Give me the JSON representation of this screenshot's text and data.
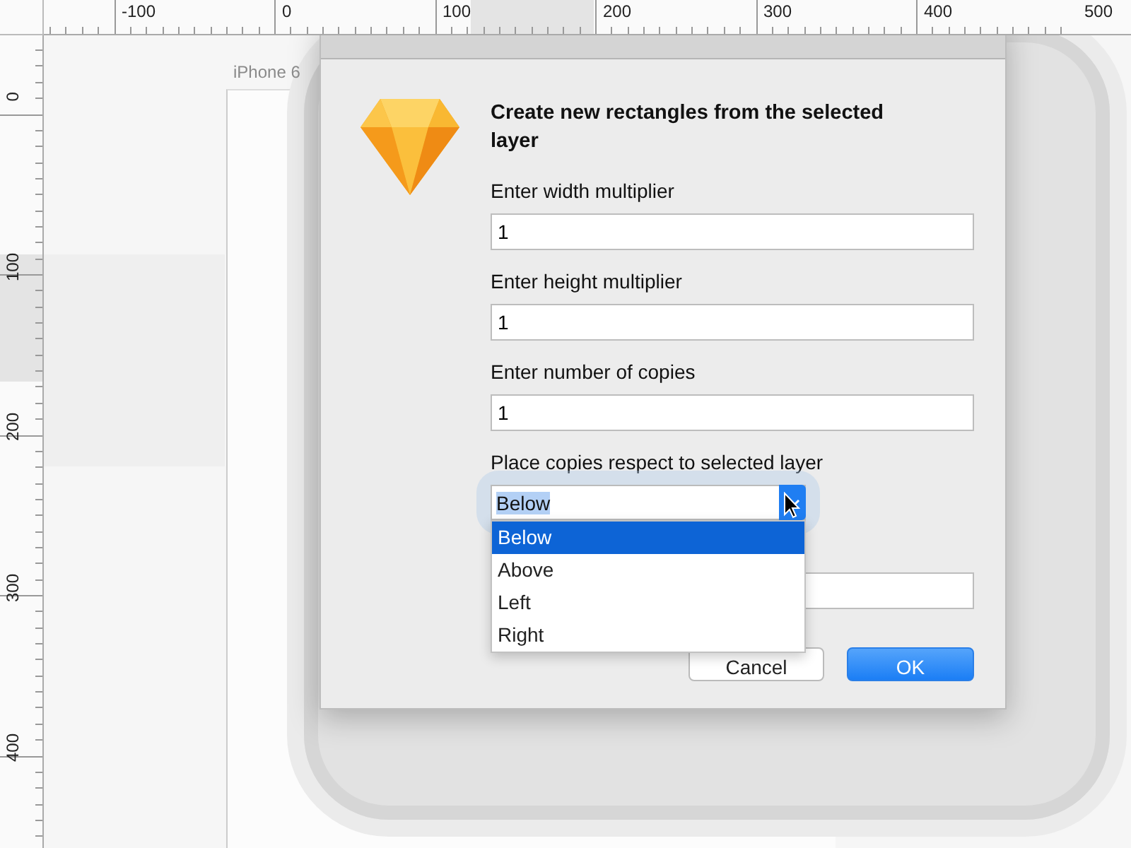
{
  "rulers": {
    "horizontal": [
      "-100",
      "0",
      "100",
      "200",
      "300",
      "400",
      "500"
    ],
    "vertical": [
      "0",
      "100",
      "200",
      "300",
      "400"
    ]
  },
  "artboard": {
    "label": "iPhone 6"
  },
  "dialog": {
    "title": "Create new rectangles from the selected layer",
    "fields": [
      {
        "label": "Enter width multiplier",
        "value": "1"
      },
      {
        "label": "Enter height multiplier",
        "value": "1"
      },
      {
        "label": "Enter number of copies",
        "value": "1"
      }
    ],
    "select": {
      "label": "Place copies respect to selected layer",
      "value": "Below",
      "expanded": true,
      "options": [
        {
          "label": "Below",
          "selected": true
        },
        {
          "label": "Above",
          "selected": false
        },
        {
          "label": "Left",
          "selected": false
        },
        {
          "label": "Right",
          "selected": false
        }
      ]
    },
    "buttons": [
      {
        "label": "Cancel",
        "kind": "secondary"
      },
      {
        "label": "OK",
        "kind": "primary"
      }
    ]
  }
}
